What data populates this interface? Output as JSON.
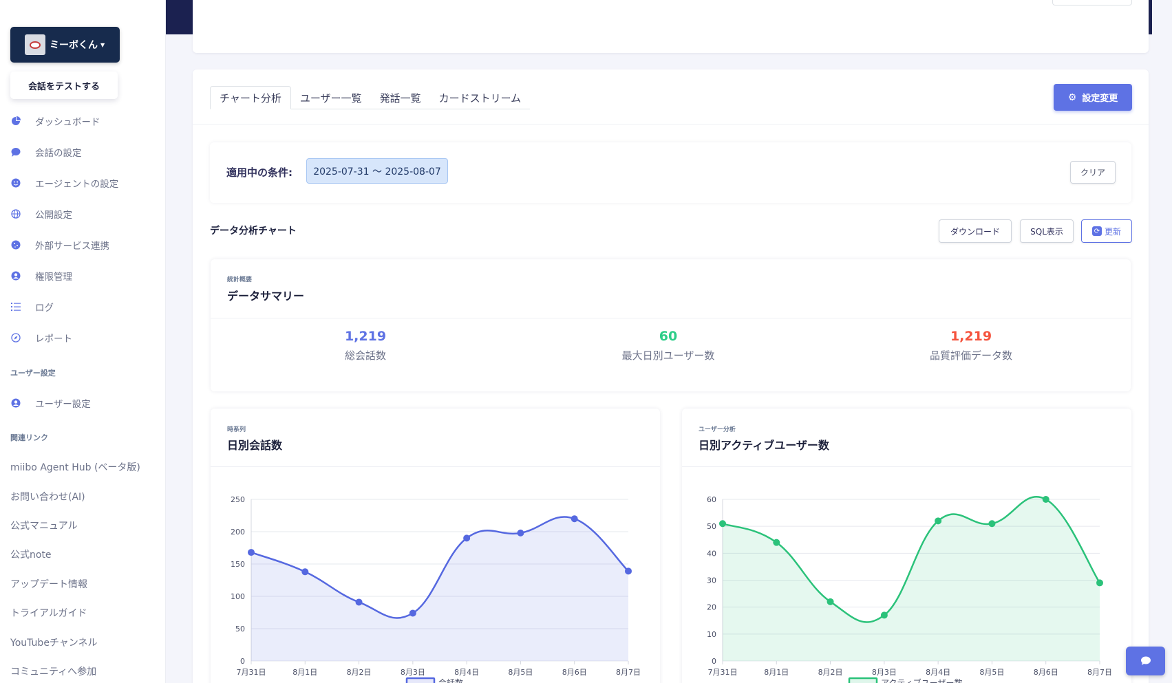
{
  "sidebar": {
    "agent_name": "ミーボくん",
    "test_button": "会話をテストする",
    "nav": [
      {
        "label": "ダッシュボード",
        "icon": "pie-chart-icon"
      },
      {
        "label": "会話の設定",
        "icon": "chat-bubble-icon"
      },
      {
        "label": "エージェントの設定",
        "icon": "smile-icon"
      },
      {
        "label": "公開設定",
        "icon": "globe-icon"
      },
      {
        "label": "外部サービス連携",
        "icon": "cookie-icon"
      },
      {
        "label": "権限管理",
        "icon": "user-circle-icon"
      },
      {
        "label": "ログ",
        "icon": "list-icon"
      },
      {
        "label": "レポート",
        "icon": "compass-icon"
      }
    ],
    "user_settings_heading": "ユーザー設定",
    "user_settings_item": "ユーザー設定",
    "links_heading": "関連リンク",
    "links": [
      "miibo Agent Hub (ベータ版)",
      "お問い合わせ(AI)",
      "公式マニュアル",
      "公式note",
      "アップデート情報",
      "トライアルガイド",
      "YouTubeチャンネル",
      "コミュニティへ参加"
    ]
  },
  "tabs": [
    "チャート分析",
    "ユーザー一覧",
    "発話一覧",
    "カードストリーム"
  ],
  "settings_button": "設定変更",
  "filter": {
    "label": "適用中の条件:",
    "range": "2025-07-31 〜 2025-08-07",
    "clear": "クリア"
  },
  "section_title": "データ分析チャート",
  "toolbar": {
    "download": "ダウンロード",
    "sql": "SQL表示",
    "refresh": "更新"
  },
  "summary": {
    "eyebrow": "統計概要",
    "title": "データサマリー",
    "stats": [
      {
        "value": "1,219",
        "label": "総会話数",
        "color": "#5e72e4"
      },
      {
        "value": "60",
        "label": "最大日別ユーザー数",
        "color": "#2dce89"
      },
      {
        "value": "1,219",
        "label": "品質評価データ数",
        "color": "#f5533d"
      }
    ]
  },
  "chart_data": [
    {
      "type": "line",
      "eyebrow": "時系列",
      "title": "日別会話数",
      "categories": [
        "7月31日",
        "8月1日",
        "8月2日",
        "8月3日",
        "8月4日",
        "8月5日",
        "8月6日",
        "8月7日"
      ],
      "series": [
        {
          "name": "会話数",
          "values": [
            168,
            138,
            91,
            74,
            190,
            198,
            220,
            139
          ],
          "color": "#5568e0"
        }
      ],
      "ylim": [
        0,
        250
      ],
      "yticks": [
        0,
        50,
        100,
        150,
        200,
        250
      ],
      "area": true,
      "grid": true,
      "legend": "bottom"
    },
    {
      "type": "line",
      "eyebrow": "ユーザー分析",
      "title": "日別アクティブユーザー数",
      "categories": [
        "7月31日",
        "8月1日",
        "8月2日",
        "8月3日",
        "8月4日",
        "8月5日",
        "8月6日",
        "8月7日"
      ],
      "series": [
        {
          "name": "アクティブユーザー数",
          "values": [
            51,
            44,
            22,
            17,
            52,
            51,
            60,
            29
          ],
          "color": "#2bc27a"
        }
      ],
      "ylim": [
        0,
        60
      ],
      "yticks": [
        0,
        10,
        20,
        30,
        40,
        50,
        60
      ],
      "area": true,
      "grid": true,
      "legend": "bottom"
    }
  ]
}
